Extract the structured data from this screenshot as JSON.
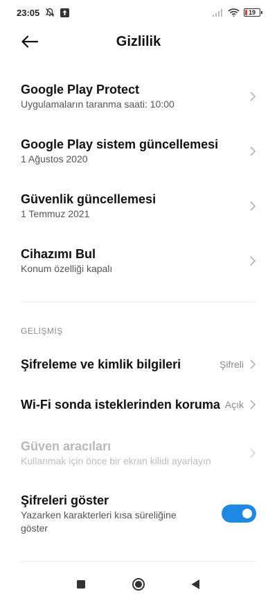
{
  "status_bar": {
    "time": "23:05",
    "battery_level": "19",
    "battery_color": "#e53935"
  },
  "header": {
    "title": "Gizlilik"
  },
  "items": [
    {
      "title": "Google Play Protect",
      "subtitle": "Uygulamaların taranma saati: 10:00"
    },
    {
      "title": "Google Play sistem güncellemesi",
      "subtitle": "1 Ağustos 2020"
    },
    {
      "title": "Güvenlik güncellemesi",
      "subtitle": "1 Temmuz 2021"
    },
    {
      "title": "Cihazımı Bul",
      "subtitle": "Konum özelliği kapalı"
    }
  ],
  "advanced": {
    "section_label": "GELİŞMİŞ",
    "encryption": {
      "title": "Şifreleme ve kimlik bilgileri",
      "value": "Şifreli"
    },
    "wifi_probe": {
      "title": "Wi-Fi sonda isteklerinden koruma",
      "value": "Açık"
    },
    "trust_agents": {
      "title": "Güven aracıları",
      "subtitle": "Kullanmak için önce bir ekran kilidi ayarlayın",
      "enabled": false
    },
    "show_passwords": {
      "title": "Şifreleri göster",
      "subtitle_line1": "Yazarken karakterleri kısa süreliğine",
      "subtitle_line2": "göster",
      "enabled": true
    }
  },
  "colors": {
    "accent": "#1e88e5"
  }
}
